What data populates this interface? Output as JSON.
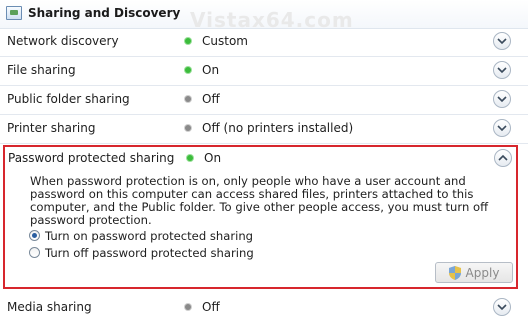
{
  "header": {
    "title": "Sharing and Discovery",
    "icon": "network-sharing-icon",
    "watermark": "Vistax64.com"
  },
  "rows": [
    {
      "label": "Network discovery",
      "status": "Custom",
      "state": "on"
    },
    {
      "label": "File sharing",
      "status": "On",
      "state": "on"
    },
    {
      "label": "Public folder sharing",
      "status": "Off",
      "state": "off"
    },
    {
      "label": "Printer sharing",
      "status": "Off (no printers installed)",
      "state": "off"
    }
  ],
  "expanded": {
    "label": "Password protected sharing",
    "status": "On",
    "state": "on",
    "description": "When password protection is on, only people who have a user account and password on this computer can access shared files, printers attached to this computer, and the Public folder. To give other people access, you must turn off password protection.",
    "options": [
      {
        "label": "Turn on password protected sharing",
        "checked": true
      },
      {
        "label": "Turn off password protected sharing",
        "checked": false
      }
    ],
    "apply_label": "Apply"
  },
  "last_row": {
    "label": "Media sharing",
    "status": "Off",
    "state": "off"
  },
  "colors": {
    "status_on": "#3cbc3c",
    "status_off": "#8a8a8a",
    "highlight_border": "#d7262d"
  }
}
